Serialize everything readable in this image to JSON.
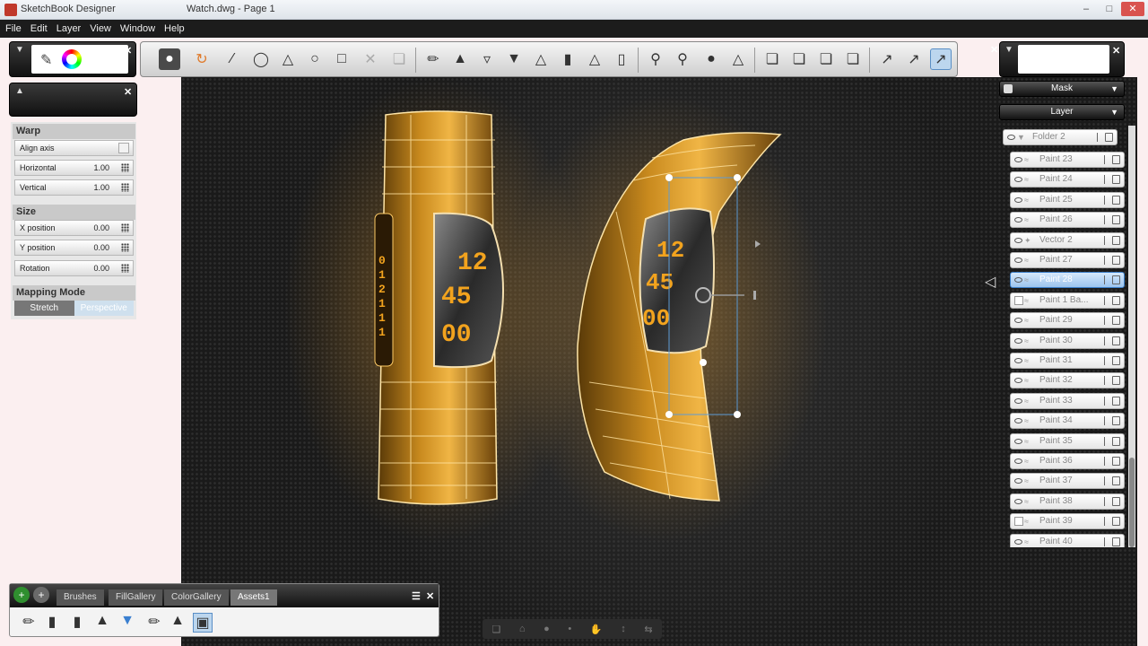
{
  "titlebar": {
    "app_name": "SketchBook Designer",
    "doc_name": "Watch.dwg - Page 1"
  },
  "menu": [
    "File",
    "Edit",
    "Layer",
    "View",
    "Window",
    "Help"
  ],
  "properties": {
    "warp": {
      "title": "Warp",
      "align_axis": "Align axis",
      "horizontal": {
        "label": "Horizontal",
        "value": "1.00"
      },
      "vertical": {
        "label": "Vertical",
        "value": "1.00"
      }
    },
    "size": {
      "title": "Size",
      "x_position": {
        "label": "X position",
        "value": "0.00"
      },
      "y_position": {
        "label": "Y position",
        "value": "0.00"
      },
      "rotation": {
        "label": "Rotation",
        "value": "0.00"
      }
    },
    "mapping": {
      "title": "Mapping Mode",
      "stretch": "Stretch",
      "perspective": "Perspective"
    }
  },
  "layers_panel": {
    "mask_label": "Mask",
    "layer_label": "Layer",
    "folder": "Folder 2",
    "items": [
      "Paint 23",
      "Paint 24",
      "Paint 25",
      "Paint 26",
      "Vector 2",
      "Paint 27",
      "Paint 28",
      "Paint 1 Ba...",
      "Paint 29",
      "Paint 30",
      "Paint 31",
      "Paint 32",
      "Paint 33",
      "Paint 34",
      "Paint 35",
      "Paint 36",
      "Paint 37",
      "Paint 38",
      "Paint 39",
      "Paint 40"
    ],
    "selected": "Paint 28"
  },
  "watch_display": {
    "hours": "12",
    "minutes": "45",
    "seconds": "00",
    "side_digits": [
      "0",
      "1",
      "2",
      "1",
      "1",
      "1"
    ]
  },
  "gallery": {
    "tabs": [
      "Brushes",
      "FillGallery",
      "ColorGallery",
      "Assets1"
    ],
    "active_tab": "Assets1"
  }
}
